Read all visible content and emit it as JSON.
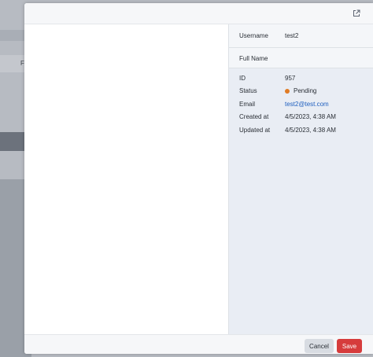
{
  "background": {
    "partial_letter": "F"
  },
  "modal": {
    "icons": {
      "open_external": "open-external-icon"
    },
    "detail": {
      "username_label": "Username",
      "username_value": "test2",
      "full_name_label": "Full Name",
      "full_name_value": "",
      "fields": {
        "id_label": "ID",
        "id_value": "957",
        "status_label": "Status",
        "status_value": "Pending",
        "status_color": "#e07b24",
        "email_label": "Email",
        "email_value": "test2@test.com",
        "created_label": "Created at",
        "created_value": "4/5/2023, 4:38 AM",
        "updated_label": "Updated at",
        "updated_value": "4/5/2023, 4:38 AM"
      }
    },
    "footer": {
      "cancel_label": "Cancel",
      "save_label": "Save"
    }
  },
  "colors": {
    "accent_link": "#1f5fbf",
    "save_button": "#d63c3c",
    "panel_background": "#e9edf4"
  }
}
